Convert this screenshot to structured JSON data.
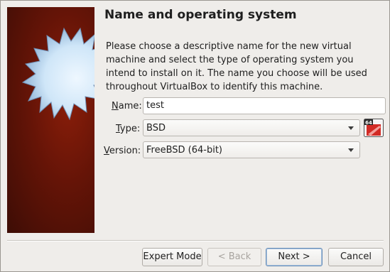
{
  "wizard": {
    "title": "Name and operating system",
    "description": "Please choose a descriptive name for the new virtual machine and select the type of operating system you intend to install on it. The name you choose will be used throughout VirtualBox to identify this machine."
  },
  "form": {
    "name": {
      "label_mnemonic": "N",
      "label_rest": "ame:",
      "value": "test"
    },
    "type": {
      "label_mnemonic": "T",
      "label_rest": "ype:",
      "selected": "BSD"
    },
    "version": {
      "label_mnemonic": "V",
      "label_rest": "ersion:",
      "selected": "FreeBSD (64-bit)"
    },
    "os_icon": {
      "name": "freebsd-64-icon",
      "badge": "64"
    }
  },
  "buttons": {
    "expert_mode": "Expert Mode",
    "back": "< Back",
    "next": "Next >",
    "cancel": "Cancel"
  },
  "colors": {
    "panel_background": "#651407",
    "starburst": "#cfe6f8",
    "window_background": "#efedea",
    "default_button_border": "#6a8fb8"
  }
}
